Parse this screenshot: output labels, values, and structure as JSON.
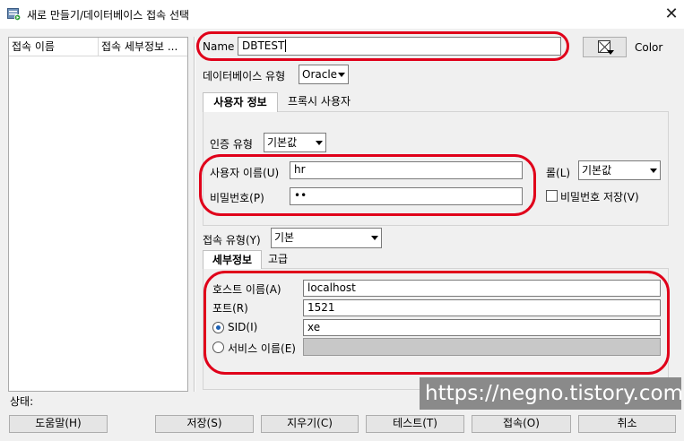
{
  "window": {
    "title": "새로 만들기/데이터베이스 접속 선택",
    "app_icon": "sql-developer-connection-icon",
    "close_icon": "close-icon"
  },
  "connections_list": {
    "columns": [
      "접속 이름",
      "접속 세부정보 ..."
    ]
  },
  "name_field": {
    "label": "Name",
    "value": "DBTEST"
  },
  "color_picker": {
    "label": "Color",
    "icon": "color-swatch-icon"
  },
  "db_type": {
    "label": "데이터베이스 유형",
    "selected": "Oracle"
  },
  "user_tabs": [
    {
      "label": "사용자 정보",
      "active": true
    },
    {
      "label": "프록시 사용자",
      "active": false
    }
  ],
  "auth_type": {
    "label": "인증 유형",
    "selected": "기본값"
  },
  "username": {
    "label": "사용자 이름(U)",
    "value": "hr"
  },
  "password": {
    "label": "비밀번호(P)",
    "value": "••"
  },
  "role": {
    "label": "롤(L)",
    "selected": "기본값"
  },
  "save_password": {
    "label": "비밀번호 저장(V)",
    "checked": false
  },
  "connection_type": {
    "label": "접속 유형(Y)",
    "selected": "기본"
  },
  "detail_tabs": [
    {
      "label": "세부정보",
      "active": true
    },
    {
      "label": "고급",
      "active": false
    }
  ],
  "host": {
    "label": "호스트 이름(A)",
    "value": "localhost"
  },
  "port": {
    "label": "포트(R)",
    "value": "1521"
  },
  "sid": {
    "label": "SID(I)",
    "value": "xe",
    "selected": true
  },
  "service_name": {
    "label": "서비스 이름(E)",
    "value": "",
    "selected": false
  },
  "status": {
    "label": "상태:"
  },
  "buttons": {
    "help": "도움말(H)",
    "save": "저장(S)",
    "clear": "지우기(C)",
    "test": "테스트(T)",
    "connect": "접속(O)",
    "cancel": "취소"
  },
  "watermark": "https://negno.tistory.com",
  "colors": {
    "annotation": "#e0001a",
    "radio_accent": "#1a5fb4"
  }
}
